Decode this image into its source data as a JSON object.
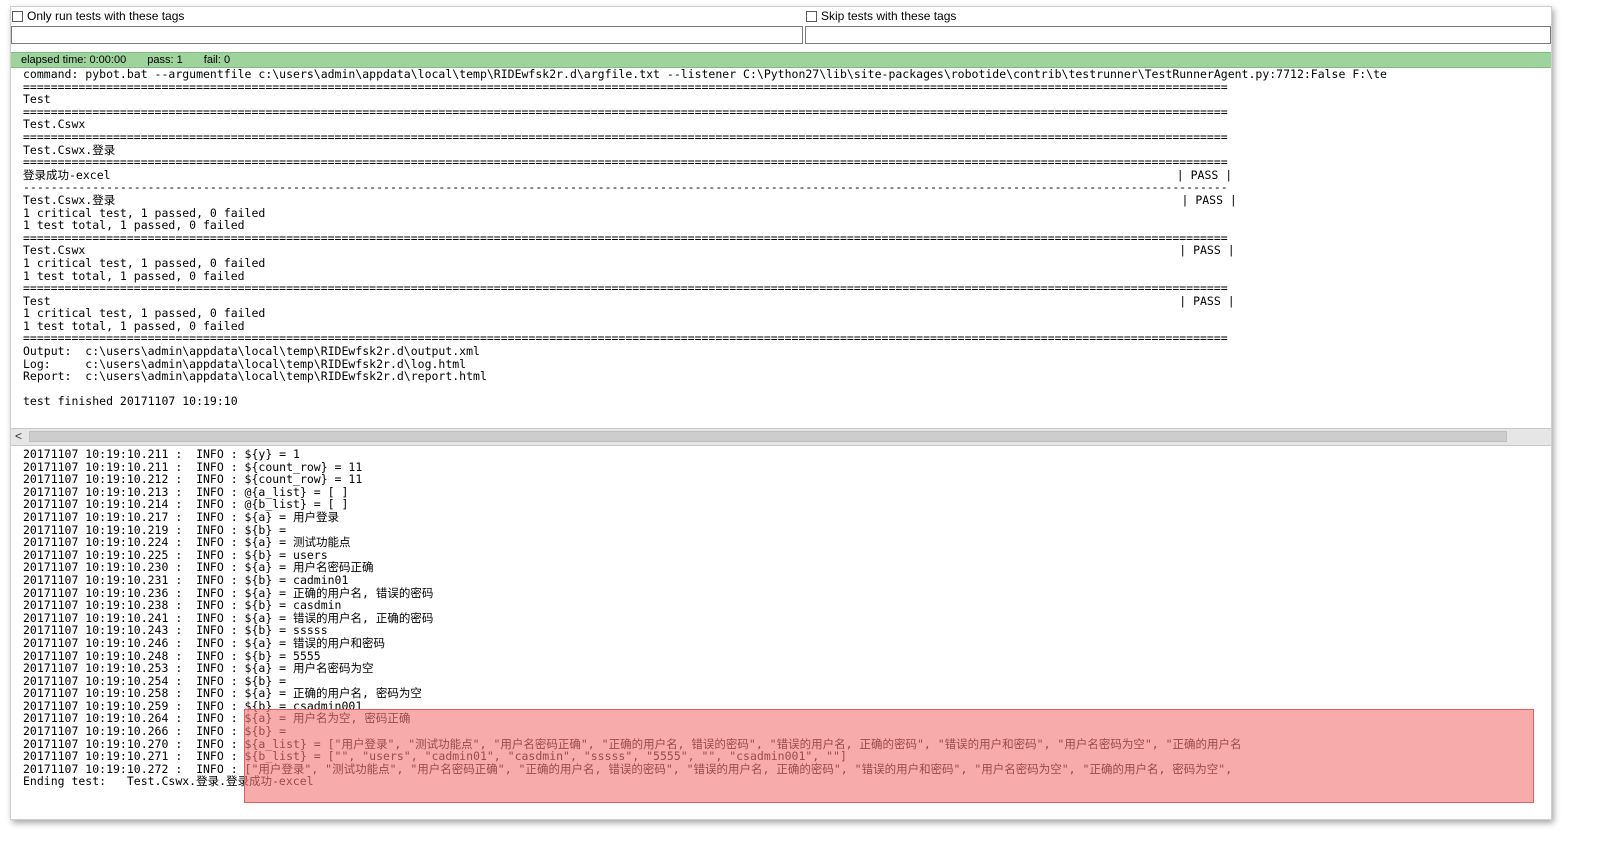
{
  "tags": {
    "only_run_label": "Only run tests with these tags",
    "skip_label": "Skip tests with these tags",
    "only_run_value": "",
    "skip_value": ""
  },
  "status": {
    "elapsed": "elapsed time: 0:00:00",
    "pass": "pass: 1",
    "fail": "fail: 0",
    "color": "#9ed39e"
  },
  "console_lines": [
    "command: pybot.bat --argumentfile c:\\users\\admin\\appdata\\local\\temp\\RIDEwfsk2r.d\\argfile.txt --listener C:\\Python27\\lib\\site-packages\\robotide\\contrib\\testrunner\\TestRunnerAgent.py:7712:False F:\\te",
    "==============================================================================================================================================================================",
    "Test",
    "==============================================================================================================================================================================",
    "Test.Cswx",
    "==============================================================================================================================================================================",
    "Test.Cswx.登录",
    "==============================================================================================================================================================================",
    "登录成功-excel                                                                                                                                                          | PASS |",
    "------------------------------------------------------------------------------------------------------------------------------------------------------------------------------",
    "Test.Cswx.登录                                                                                                                                                          | PASS |",
    "1 critical test, 1 passed, 0 failed",
    "1 test total, 1 passed, 0 failed",
    "==============================================================================================================================================================================",
    "Test.Cswx                                                                                                                                                              | PASS |",
    "1 critical test, 1 passed, 0 failed",
    "1 test total, 1 passed, 0 failed",
    "==============================================================================================================================================================================",
    "Test                                                                                                                                                                   | PASS |",
    "1 critical test, 1 passed, 0 failed",
    "1 test total, 1 passed, 0 failed",
    "==============================================================================================================================================================================",
    "Output:  c:\\users\\admin\\appdata\\local\\temp\\RIDEwfsk2r.d\\output.xml",
    "Log:     c:\\users\\admin\\appdata\\local\\temp\\RIDEwfsk2r.d\\log.html",
    "Report:  c:\\users\\admin\\appdata\\local\\temp\\RIDEwfsk2r.d\\report.html",
    "",
    "test finished 20171107 10:19:10"
  ],
  "scroll_arrow": "<",
  "log_lines": [
    "20171107 10:19:10.211 :  INFO : ${y} = 1",
    "20171107 10:19:10.211 :  INFO : ${count_row} = 11",
    "20171107 10:19:10.212 :  INFO : ${count_row} = 11",
    "20171107 10:19:10.213 :  INFO : @{a_list} = [ ]",
    "20171107 10:19:10.214 :  INFO : @{b_list} = [ ]",
    "20171107 10:19:10.217 :  INFO : ${a} = 用户登录",
    "20171107 10:19:10.219 :  INFO : ${b} =",
    "20171107 10:19:10.224 :  INFO : ${a} = 测试功能点",
    "20171107 10:19:10.225 :  INFO : ${b} = users",
    "20171107 10:19:10.230 :  INFO : ${a} = 用户名密码正确",
    "20171107 10:19:10.231 :  INFO : ${b} = cadmin01",
    "20171107 10:19:10.236 :  INFO : ${a} = 正确的用户名, 错误的密码",
    "20171107 10:19:10.238 :  INFO : ${b} = casdmin",
    "20171107 10:19:10.241 :  INFO : ${a} = 错误的用户名, 正确的密码",
    "20171107 10:19:10.243 :  INFO : ${b} = sssss",
    "20171107 10:19:10.246 :  INFO : ${a} = 错误的用户和密码",
    "20171107 10:19:10.248 :  INFO : ${b} = 5555",
    "20171107 10:19:10.253 :  INFO : ${a} = 用户名密码为空",
    "20171107 10:19:10.254 :  INFO : ${b} =",
    "20171107 10:19:10.258 :  INFO : ${a} = 正确的用户名, 密码为空",
    "20171107 10:19:10.259 :  INFO : ${b} = csadmin001",
    "20171107 10:19:10.264 :  INFO : ${a} = 用户名为空, 密码正确",
    "20171107 10:19:10.266 :  INFO : ${b} =",
    "20171107 10:19:10.270 :  INFO : ${a_list} = [\"用户登录\", \"测试功能点\", \"用户名密码正确\", \"正确的用户名, 错误的密码\", \"错误的用户名, 正确的密码\", \"错误的用户和密码\", \"用户名密码为空\", \"正确的用户名",
    "20171107 10:19:10.271 :  INFO : ${b_list} = [\"\", \"users\", \"cadmin01\", \"casdmin\", \"sssss\", \"5555\", \"\", \"csadmin001\", \"\"]",
    "20171107 10:19:10.272 :  INFO : [\"用户登录\", \"测试功能点\", \"用户名密码正确\", \"正确的用户名, 错误的密码\", \"错误的用户名, 正确的密码\", \"错误的用户和密码\", \"用户名密码为空\", \"正确的用户名, 密码为空\",",
    "Ending test:   Test.Cswx.登录.登录成功-excel"
  ],
  "highlight_color": "#f47878"
}
